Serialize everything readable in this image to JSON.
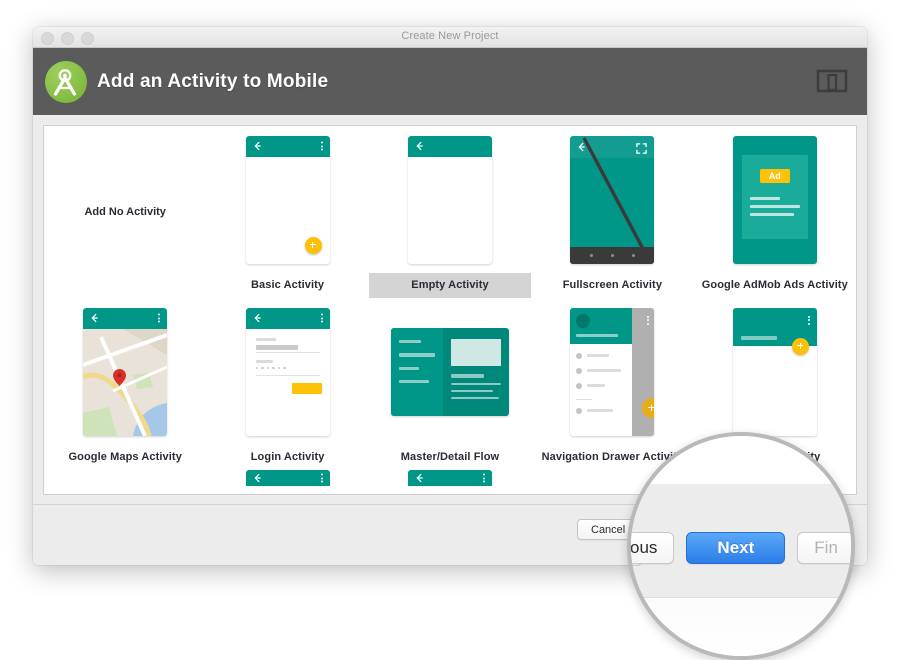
{
  "window": {
    "title": "Create New Project",
    "traffic_lights": [
      "close",
      "minimize",
      "zoom"
    ]
  },
  "header": {
    "title": "Add an Activity to Mobile",
    "logo_icon": "android-studio-logo",
    "device_icon": "device-preview-icon"
  },
  "grid": {
    "items": [
      {
        "label": "Add No Activity",
        "thumb": "none",
        "selected": false
      },
      {
        "label": "Basic Activity",
        "thumb": "basic",
        "selected": false
      },
      {
        "label": "Empty Activity",
        "thumb": "empty",
        "selected": true
      },
      {
        "label": "Fullscreen Activity",
        "thumb": "fullscreen",
        "selected": false
      },
      {
        "label": "Google AdMob Ads Activity",
        "thumb": "admob",
        "selected": false
      },
      {
        "label": "Google Maps Activity",
        "thumb": "maps",
        "selected": false
      },
      {
        "label": "Login Activity",
        "thumb": "login",
        "selected": false
      },
      {
        "label": "Master/Detail Flow",
        "thumb": "masterdetail",
        "selected": false
      },
      {
        "label": "Navigation Drawer Activity",
        "thumb": "navdrawer",
        "selected": false
      },
      {
        "label": "Scrolling Activity",
        "thumb": "scrolling",
        "selected": false
      }
    ],
    "ad_badge_label": "Ad"
  },
  "footer": {
    "cancel_label": "Cancel",
    "previous_label": "Previous",
    "next_label": "Next",
    "finish_label": "Finish"
  },
  "magnifier": {
    "previous_partial": "ous",
    "next_label": "Next",
    "finish_partial": "Fin"
  },
  "colors": {
    "teal": "#009688",
    "teal_dark": "#00897b",
    "amber": "#ffc107",
    "accent_blue": "#2f7fe8",
    "banner_gray": "#5b5b5b",
    "selected_gray": "#d4d4d4"
  }
}
